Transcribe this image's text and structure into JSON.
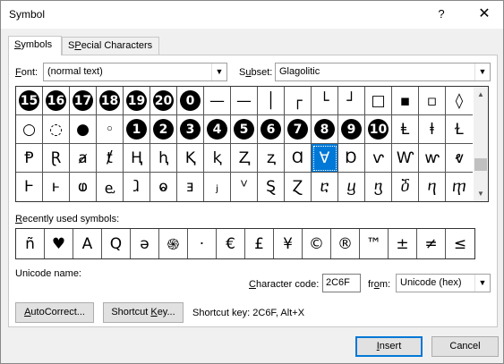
{
  "window": {
    "title": "Symbol",
    "help_glyph": "?",
    "close_glyph": "✕"
  },
  "tabs": [
    {
      "label": "Symbols",
      "ul": "S",
      "rest": "ymbols"
    },
    {
      "label": "Special Characters",
      "ul": "P",
      "pre": "S",
      "rest": "ecial Characters"
    }
  ],
  "font": {
    "label_ul": "F",
    "label_rest": "ont:",
    "value": "(normal text)"
  },
  "subset": {
    "label_pre": "S",
    "label_ul": "u",
    "label_rest": "bset:",
    "value": "Glagolitic"
  },
  "grid": [
    [
      {
        "t": "15",
        "c": 1
      },
      {
        "t": "16",
        "c": 1
      },
      {
        "t": "17",
        "c": 1
      },
      {
        "t": "18",
        "c": 1
      },
      {
        "t": "19",
        "c": 1
      },
      {
        "t": "20",
        "c": 1
      },
      {
        "t": "0",
        "c": 1
      },
      {
        "t": "—"
      },
      {
        "t": "—"
      },
      {
        "t": "│"
      },
      {
        "t": "┌"
      },
      {
        "t": "└"
      },
      {
        "t": "┘"
      },
      {
        "t": "□"
      },
      {
        "t": "▪"
      },
      {
        "t": "▫"
      },
      {
        "t": "◊"
      }
    ],
    [
      {
        "t": "○"
      },
      {
        "t": "◌"
      },
      {
        "t": "●"
      },
      {
        "t": "◦"
      },
      {
        "t": "1",
        "c": 1
      },
      {
        "t": "2",
        "c": 1
      },
      {
        "t": "3",
        "c": 1
      },
      {
        "t": "4",
        "c": 1
      },
      {
        "t": "5",
        "c": 1
      },
      {
        "t": "6",
        "c": 1
      },
      {
        "t": "7",
        "c": 1
      },
      {
        "t": "8",
        "c": 1
      },
      {
        "t": "9",
        "c": 1
      },
      {
        "t": "10",
        "c": 1
      },
      {
        "t": "Ⱡ"
      },
      {
        "t": "ⱡ"
      },
      {
        "t": "Ɫ"
      }
    ],
    [
      {
        "t": "Ᵽ"
      },
      {
        "t": "Ɽ"
      },
      {
        "t": "ⱥ"
      },
      {
        "t": "ⱦ"
      },
      {
        "t": "Ⱨ"
      },
      {
        "t": "ⱨ"
      },
      {
        "t": "Ⱪ"
      },
      {
        "t": "ⱪ"
      },
      {
        "t": "Ⱬ"
      },
      {
        "t": "ⱬ"
      },
      {
        "t": "Ɑ"
      },
      {
        "t": "Ɐ",
        "sel": 1
      },
      {
        "t": "Ɒ"
      },
      {
        "t": "ⱱ"
      },
      {
        "t": "Ⱳ"
      },
      {
        "t": "ⱳ"
      },
      {
        "t": "ⱴ"
      }
    ],
    [
      {
        "t": "Ⱶ"
      },
      {
        "t": "ⱶ"
      },
      {
        "t": "ⱷ"
      },
      {
        "t": "ⱸ"
      },
      {
        "t": "ⱹ"
      },
      {
        "t": "ⱺ"
      },
      {
        "t": "ⱻ"
      },
      {
        "t": "ⱼ"
      },
      {
        "t": "ⱽ"
      },
      {
        "t": "Ȿ"
      },
      {
        "t": "Ɀ"
      },
      {
        "t": "ⴀ"
      },
      {
        "t": "ⴁ"
      },
      {
        "t": "ⴂ"
      },
      {
        "t": "ⴃ"
      },
      {
        "t": "ⴄ"
      },
      {
        "t": "ⴅ"
      }
    ]
  ],
  "recent": {
    "label": "Recently used symbols:",
    "label_ul": "R",
    "label_rest": "ecently used symbols:",
    "items": [
      "ñ",
      "♥",
      "A",
      "Q",
      "ə",
      "֍",
      "·",
      "€",
      "£",
      "¥",
      "©",
      "®",
      "™",
      "±",
      "≠",
      "≤",
      "≥"
    ]
  },
  "unicode_name": {
    "label": "Unicode name:"
  },
  "char_code": {
    "label_ul": "C",
    "label_pre": "",
    "label": "haracter code:",
    "value": "2C6F"
  },
  "from": {
    "label_pre": "fr",
    "label_ul": "o",
    "label_rest": "m:",
    "value": "Unicode (hex)"
  },
  "buttons": {
    "autocorrect": {
      "ul": "A",
      "rest": "utoCorrect..."
    },
    "shortcut": {
      "pre": "Shortcut ",
      "ul": "K",
      "rest": "ey..."
    },
    "insert": {
      "ul": "I",
      "rest": "nsert"
    },
    "cancel": "Cancel"
  },
  "shortcut_key_text": "Shortcut key: 2C6F, Alt+X",
  "colors": {
    "accent": "#0078d7",
    "dialog_bg": "#f0f0f0"
  }
}
